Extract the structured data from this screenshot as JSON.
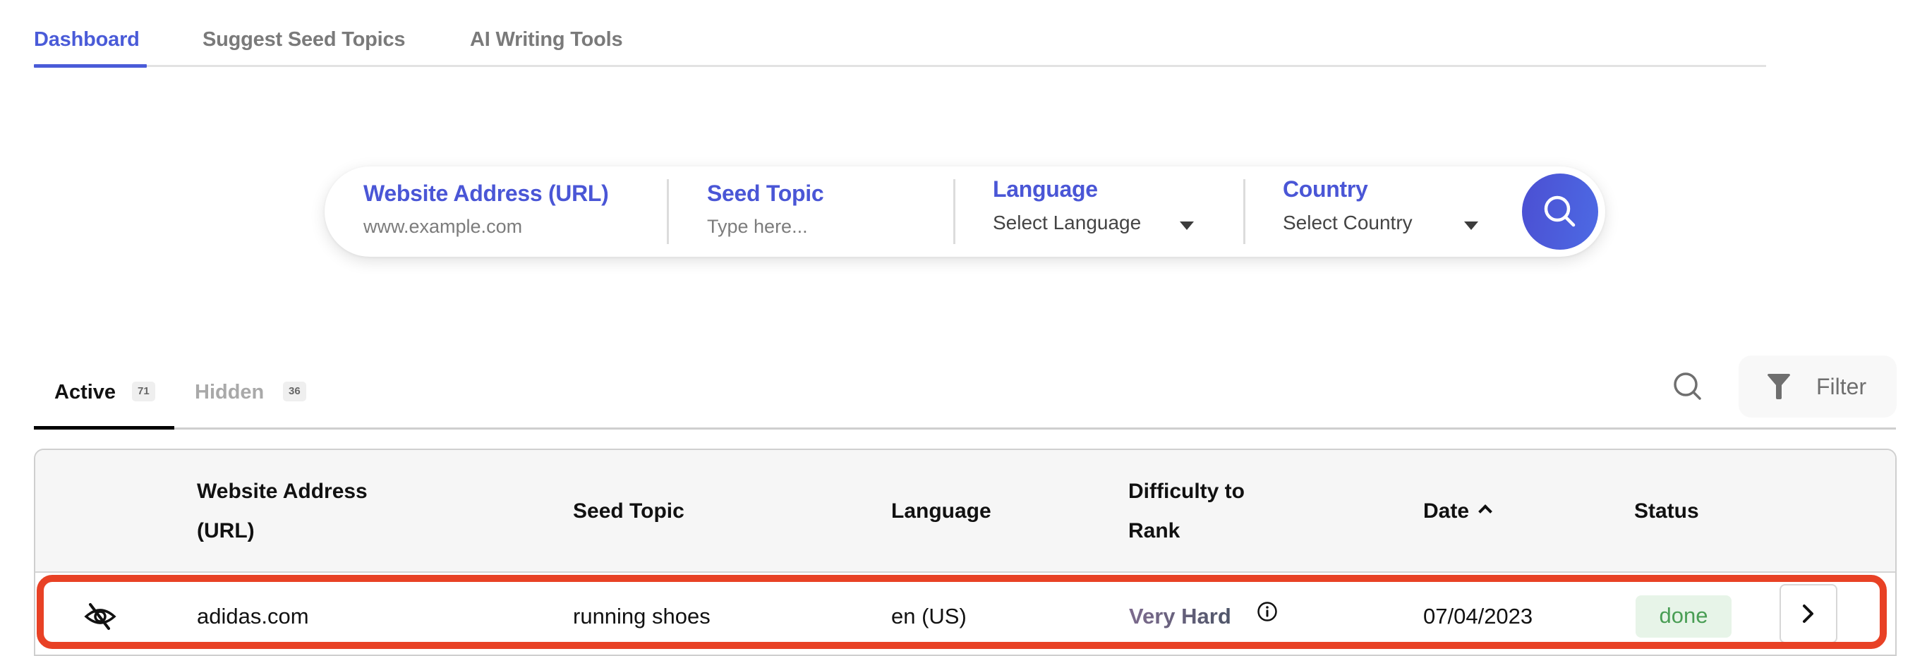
{
  "top_nav": {
    "tabs": [
      {
        "label": "Dashboard",
        "active": true
      },
      {
        "label": "Suggest Seed Topics",
        "active": false
      },
      {
        "label": "AI Writing Tools",
        "active": false
      }
    ],
    "accent_color": "#4a5bd8"
  },
  "search_bar": {
    "url": {
      "label": "Website Address (URL)",
      "placeholder": "www.example.com",
      "value": ""
    },
    "seed_topic": {
      "label": "Seed Topic",
      "placeholder": "Type here...",
      "value": ""
    },
    "language": {
      "label": "Language",
      "selected": "Select Language"
    },
    "country": {
      "label": "Country",
      "selected": "Select Country"
    },
    "submit_icon": "search-icon"
  },
  "list_tabs": {
    "tabs": [
      {
        "label": "Active",
        "count": "71",
        "active": true
      },
      {
        "label": "Hidden",
        "count": "36",
        "active": false
      }
    ],
    "search_icon": "search-icon",
    "filter": {
      "label": "Filter",
      "icon": "funnel-icon"
    }
  },
  "table": {
    "columns": [
      {
        "label": "Website Address (URL)"
      },
      {
        "label": "Seed Topic"
      },
      {
        "label": "Language"
      },
      {
        "label": "Difficulty to Rank"
      },
      {
        "label": "Date",
        "sort": "ascending"
      },
      {
        "label": "Status"
      }
    ],
    "column_lines": {
      "url": [
        "Website Address",
        "(URL)"
      ],
      "difficulty": [
        "Difficulty to",
        "Rank"
      ]
    },
    "rows": [
      {
        "visibility_icon": "eye-off-icon",
        "url": "adidas.com",
        "seed_topic": "running shoes",
        "language": "en (US)",
        "difficulty": "Very Hard",
        "date": "07/04/2023",
        "status": "done",
        "highlighted": true
      }
    ]
  },
  "colors": {
    "status_done_text": "#4a9e55",
    "status_done_bg": "#e7f4e8",
    "highlight": "#e84125",
    "search_button": "#4d5fdc"
  }
}
